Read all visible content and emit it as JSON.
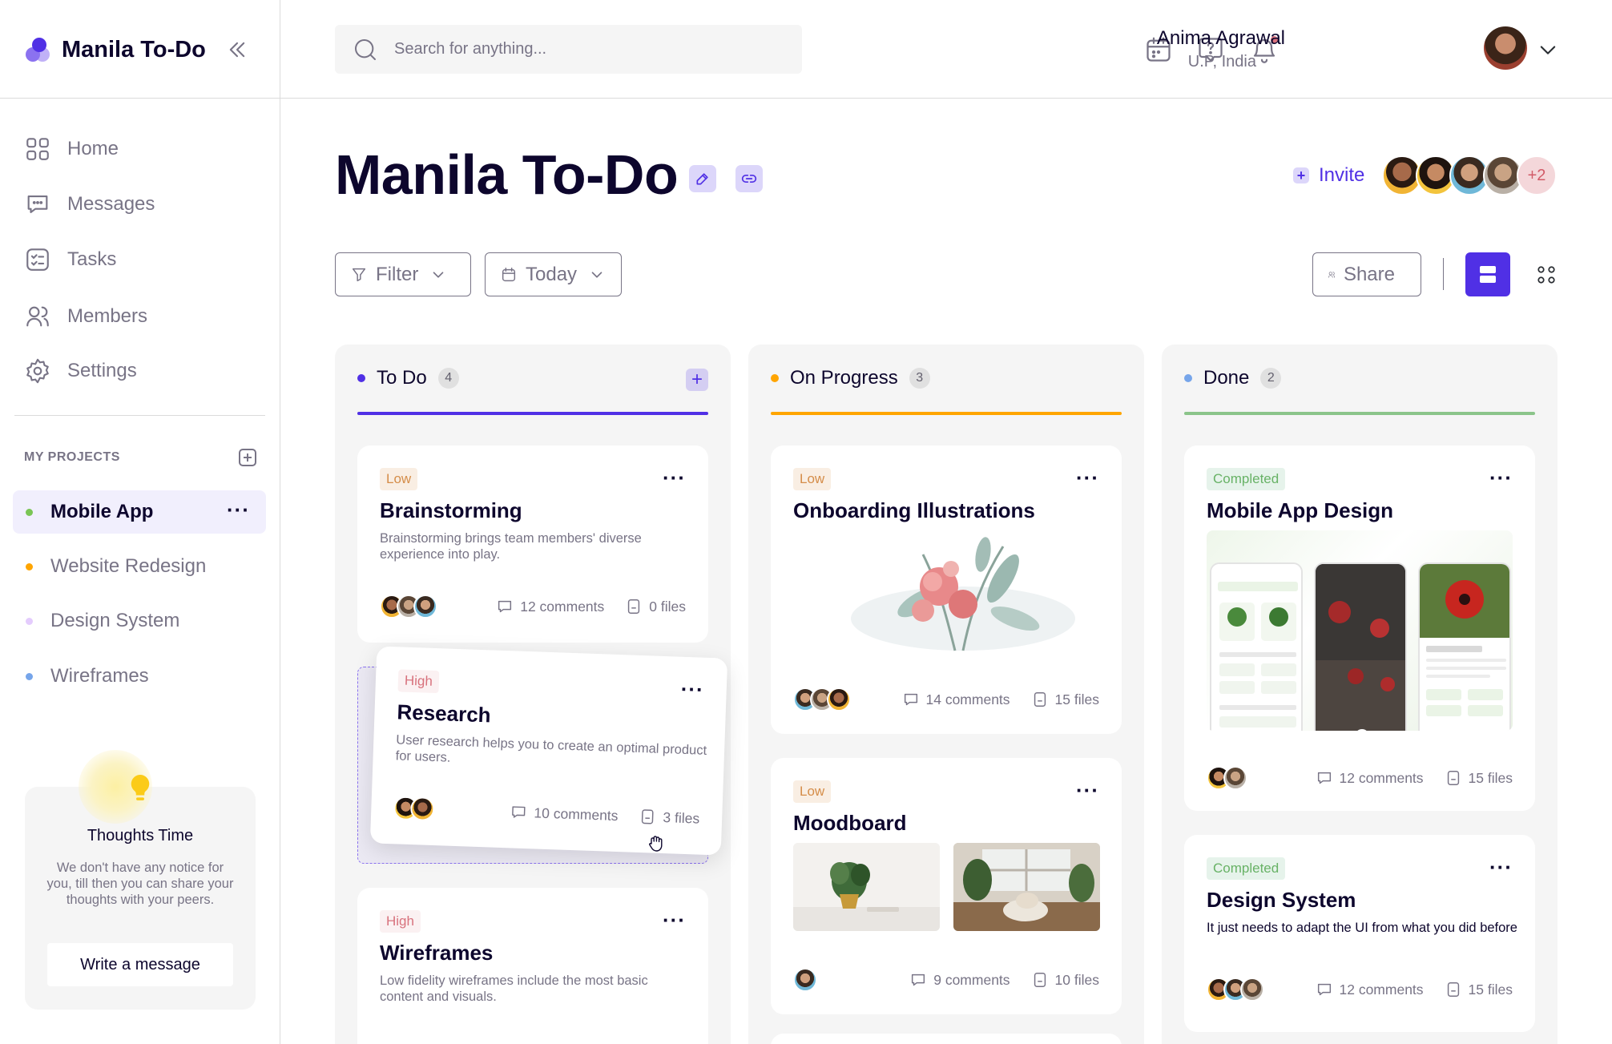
{
  "app": {
    "name": "Manila To-Do"
  },
  "sidebar": {
    "nav": [
      {
        "label": "Home",
        "icon": "grid-icon"
      },
      {
        "label": "Messages",
        "icon": "message-icon"
      },
      {
        "label": "Tasks",
        "icon": "task-list-icon"
      },
      {
        "label": "Members",
        "icon": "members-icon"
      },
      {
        "label": "Settings",
        "icon": "gear-icon"
      }
    ],
    "projects_label": "MY PROJECTS",
    "projects": [
      {
        "name": "Mobile App",
        "color": "#7ac555",
        "active": true
      },
      {
        "name": "Website Redesign",
        "color": "#ffa500",
        "active": false
      },
      {
        "name": "Design System",
        "color": "#e4ccfd",
        "active": false
      },
      {
        "name": "Wireframes",
        "color": "#76a5ea",
        "active": false
      }
    ],
    "thoughts": {
      "title": "Thoughts Time",
      "text": "We don't have any notice for you, till then you can share your thoughts with your peers.",
      "button": "Write a message"
    }
  },
  "header": {
    "search_placeholder": "Search for anything...",
    "user_name": "Anima Agrawal",
    "user_location": "U.P, India"
  },
  "page": {
    "title": "Manila To-Do",
    "invite_label": "Invite",
    "team_more": "+2",
    "filter_label": "Filter",
    "date_label": "Today",
    "share_label": "Share"
  },
  "colors": {
    "accent": "#5030e5",
    "todo": "#5030e5",
    "progress": "#ffa500",
    "done": "#8bc48a"
  },
  "board": {
    "columns": [
      {
        "name": "To Do",
        "count": "4",
        "cards": [
          {
            "priority": "Low",
            "title": "Brainstorming",
            "desc": "Brainstorming brings team members' diverse experience into play.",
            "comments": "12 comments",
            "files": "0 files"
          },
          {
            "priority": "High",
            "title": "Research",
            "desc": "User research helps you to create an optimal product for users.",
            "comments": "10 comments",
            "files": "3 files"
          },
          {
            "priority": "High",
            "title": "Wireframes",
            "desc": "Low fidelity wireframes include the most basic content and visuals."
          }
        ]
      },
      {
        "name": "On Progress",
        "count": "3",
        "cards": [
          {
            "priority": "Low",
            "title": "Onboarding Illustrations",
            "comments": "14 comments",
            "files": "15 files"
          },
          {
            "priority": "Low",
            "title": "Moodboard",
            "comments": "9 comments",
            "files": "10 files"
          }
        ]
      },
      {
        "name": "Done",
        "count": "2",
        "cards": [
          {
            "priority": "Completed",
            "title": "Mobile App Design",
            "comments": "12 comments",
            "files": "15 files"
          },
          {
            "priority": "Completed",
            "title": "Design System",
            "desc": "It just needs to adapt the UI from what you did before",
            "comments": "12 comments",
            "files": "15 files"
          }
        ]
      }
    ]
  }
}
